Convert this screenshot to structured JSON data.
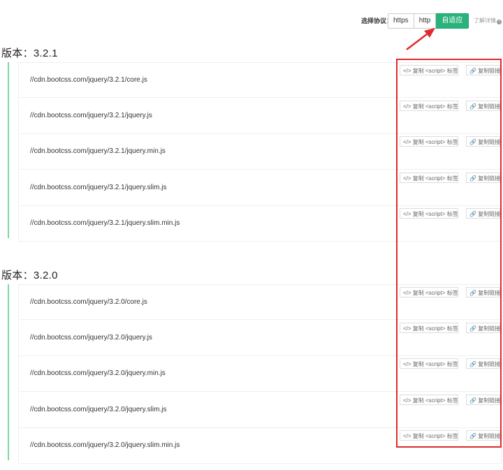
{
  "protocol": {
    "label": "选择协议：",
    "options": [
      "https",
      "http",
      "自适应"
    ],
    "selected": "自适应",
    "details_link": "了解详情",
    "active_color": "#2ab27b"
  },
  "highlight_color": "#e02a2a",
  "actions": {
    "copy_script": "</> 复制 <script> 标签",
    "copy_link": "🔗 复制链接"
  },
  "versions": [
    {
      "title": "版本：3.2.1",
      "files": [
        "//cdn.bootcss.com/jquery/3.2.1/core.js",
        "//cdn.bootcss.com/jquery/3.2.1/jquery.js",
        "//cdn.bootcss.com/jquery/3.2.1/jquery.min.js",
        "//cdn.bootcss.com/jquery/3.2.1/jquery.slim.js",
        "//cdn.bootcss.com/jquery/3.2.1/jquery.slim.min.js"
      ]
    },
    {
      "title": "版本：3.2.0",
      "files": [
        "//cdn.bootcss.com/jquery/3.2.0/core.js",
        "//cdn.bootcss.com/jquery/3.2.0/jquery.js",
        "//cdn.bootcss.com/jquery/3.2.0/jquery.min.js",
        "//cdn.bootcss.com/jquery/3.2.0/jquery.slim.js",
        "//cdn.bootcss.com/jquery/3.2.0/jquery.slim.min.js"
      ]
    }
  ]
}
